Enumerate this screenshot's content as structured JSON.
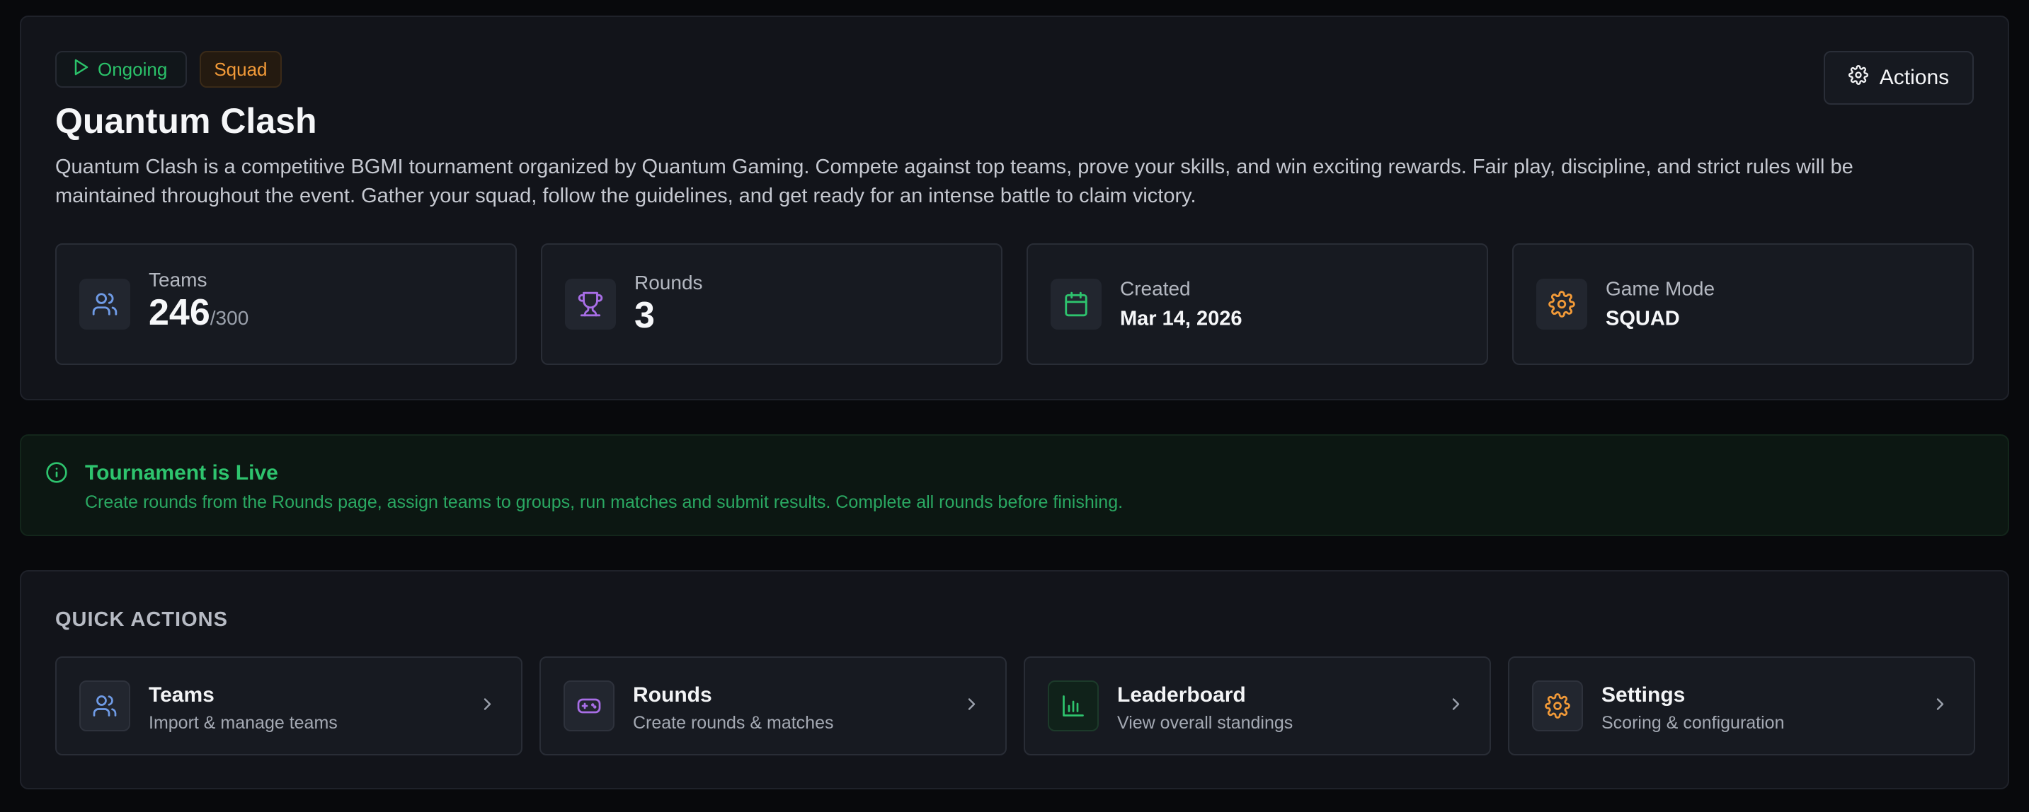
{
  "header": {
    "badges": {
      "status": "Ongoing",
      "mode": "Squad"
    },
    "actions_label": "Actions",
    "title": "Quantum Clash",
    "description": "Quantum Clash is a competitive BGMI tournament organized by Quantum Gaming. Compete against top teams, prove your skills, and win exciting rewards. Fair play, discipline, and strict rules will be maintained throughout the event. Gather your squad, follow the guidelines, and get ready for an intense battle to claim victory."
  },
  "stats": {
    "teams": {
      "label": "Teams",
      "value": "246",
      "max": "/300",
      "icon": "users-icon"
    },
    "rounds": {
      "label": "Rounds",
      "value": "3",
      "icon": "trophy-icon"
    },
    "created": {
      "label": "Created",
      "value": "Mar 14, 2026",
      "icon": "calendar-icon"
    },
    "game_mode": {
      "label": "Game Mode",
      "value": "SQUAD",
      "icon": "gear-icon"
    }
  },
  "live_notice": {
    "title": "Tournament is Live",
    "description": "Create rounds from the Rounds page, assign teams to groups, run matches and submit results. Complete all rounds before finishing."
  },
  "quick_actions": {
    "title": "QUICK ACTIONS",
    "items": [
      {
        "label": "Teams",
        "sub": "Import & manage teams",
        "icon": "users-icon"
      },
      {
        "label": "Rounds",
        "sub": "Create rounds & matches",
        "icon": "gamepad-icon"
      },
      {
        "label": "Leaderboard",
        "sub": "View overall standings",
        "icon": "bar-chart-icon"
      },
      {
        "label": "Settings",
        "sub": "Scoring & configuration",
        "icon": "gear-icon"
      }
    ]
  },
  "colors": {
    "accent_green": "#2ec46e",
    "accent_orange": "#f29a38",
    "accent_blue": "#6f9be6",
    "accent_purple": "#a86ee6",
    "background": "#08090c",
    "panel": "#12141a"
  }
}
